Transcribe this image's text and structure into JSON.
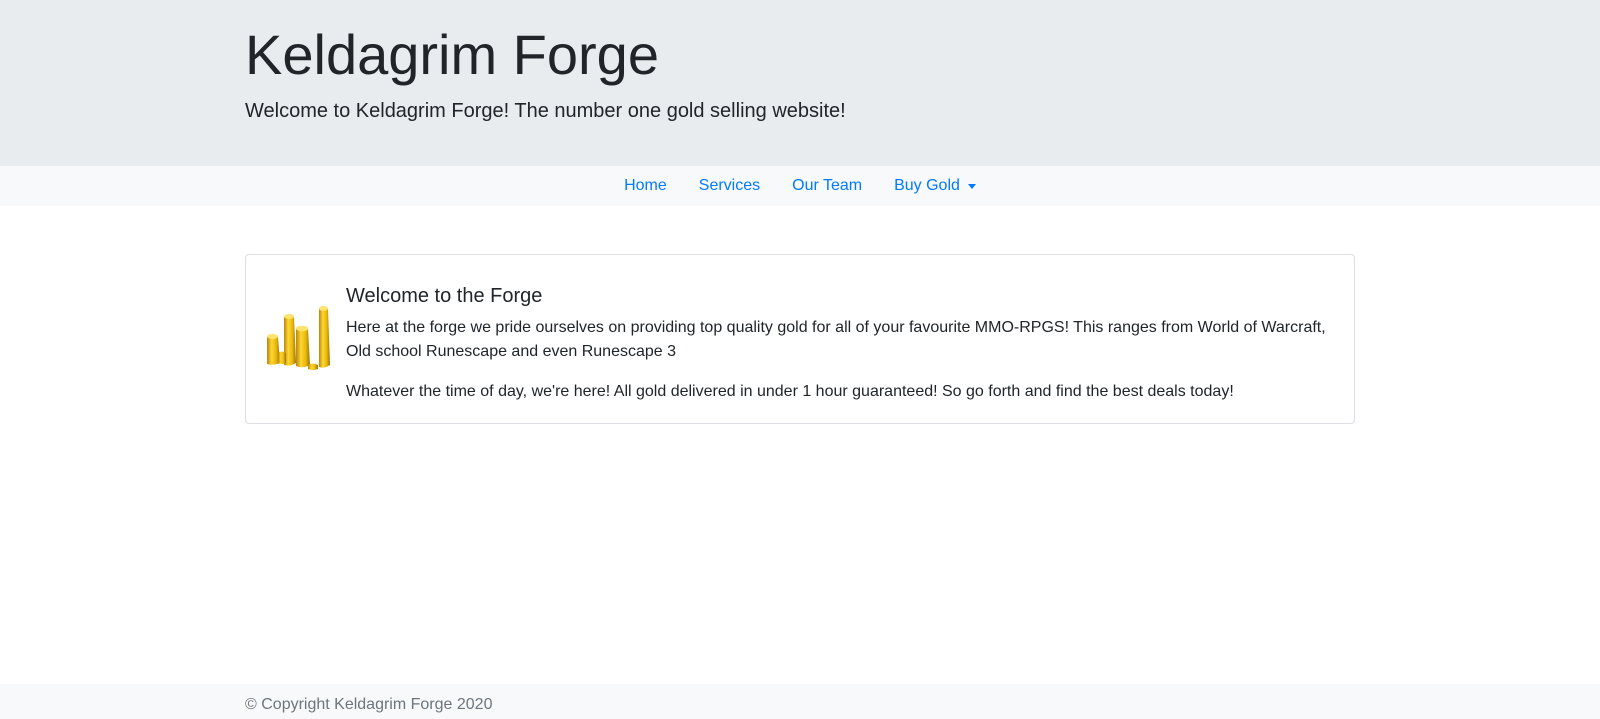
{
  "header": {
    "title": "Keldagrim Forge",
    "lead": "Welcome to Keldagrim Forge! The number one gold selling website!"
  },
  "nav": {
    "items": [
      {
        "label": "Home"
      },
      {
        "label": "Services"
      },
      {
        "label": "Our Team"
      },
      {
        "label": "Buy Gold",
        "dropdown": true
      }
    ]
  },
  "card": {
    "image_icon": "gold-bars-icon",
    "heading": "Welcome to the Forge",
    "paragraphs": [
      "Here at the forge we pride ourselves on providing top quality gold for all of your favourite MMO-RPGS! This ranges from World of Warcraft, Old school Runescape and even Runescape 3",
      "Whatever the time of day, we're here! All gold delivered in under 1 hour guaranteed! So go forth and find the best deals today!"
    ]
  },
  "footer": {
    "text": "© Copyright Keldagrim Forge 2020"
  },
  "colors": {
    "jumbotron_bg": "#e9ecef",
    "navbar_bg": "#f8f9fa",
    "link": "#007bff",
    "footer_text": "#6c757d",
    "gold": "#e8b80c"
  }
}
